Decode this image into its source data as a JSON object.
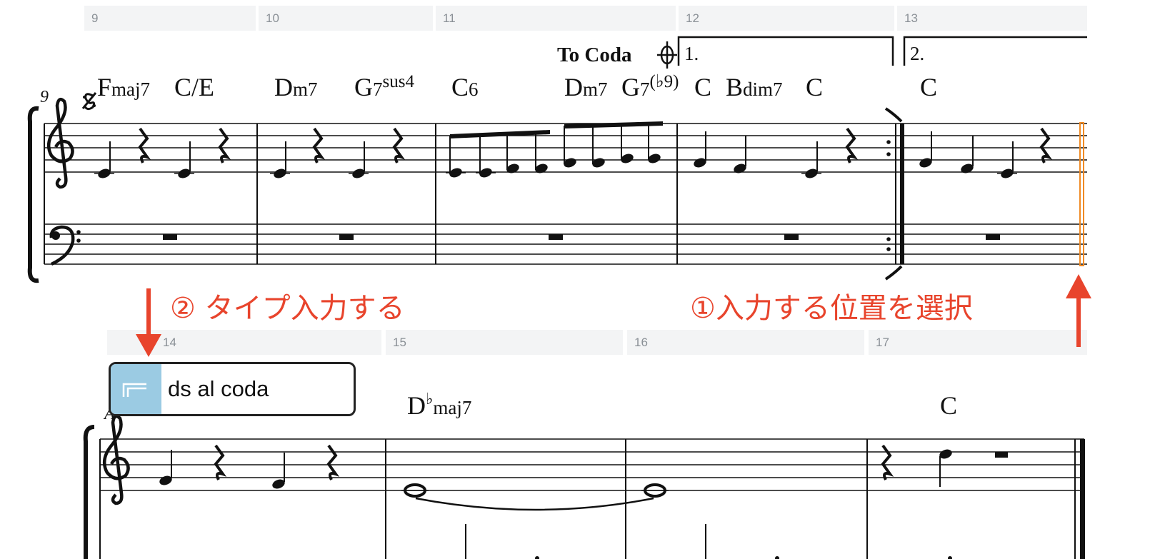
{
  "measure_bar_top": [
    "9",
    "10",
    "11",
    "12",
    "13"
  ],
  "measure_bar_bottom": [
    "14",
    "15",
    "16",
    "17"
  ],
  "chords_top": {
    "fmaj7_root": "F",
    "fmaj7_ext": "maj7",
    "ce": "C/E",
    "dm7_root": "D",
    "dm7_ext": "m7",
    "g7sus4_root": "G",
    "g7sus4_num": "7",
    "g7sus4_sup": "sus4",
    "c6_root": "C",
    "c6_ext": "6",
    "dm7b_root": "D",
    "dm7b_ext": "m7",
    "g7b9_root": "G",
    "g7b9_num": "7",
    "g7b9_sup": "(♭9)",
    "c_a": "C",
    "bdim7_root": "B",
    "bdim7_ext": "dim7",
    "c_b": "C",
    "c_c": "C"
  },
  "chords_bottom": {
    "dbmaj7_root": "D",
    "dbmaj7_acc": "♭",
    "dbmaj7_ext": "maj7",
    "c": "C"
  },
  "to_coda": "To Coda",
  "volta": {
    "first": "1.",
    "second": "2."
  },
  "measure_number": "9",
  "rehearsal_letter": "A",
  "annotations": {
    "type_input": "② タイプ入力する",
    "select_position": "①入力する位置を選択"
  },
  "popup": {
    "value": "ds al coda",
    "icon": "volta-bracket-icon"
  },
  "colors": {
    "annotation": "#e8442c",
    "selection": "#f08a24",
    "popup_icon_bg": "#9bcbe3"
  },
  "icons": [
    "segno-icon",
    "coda-icon",
    "treble-clef-icon",
    "bass-clef-icon",
    "down-arrow-icon",
    "up-arrow-icon"
  ]
}
